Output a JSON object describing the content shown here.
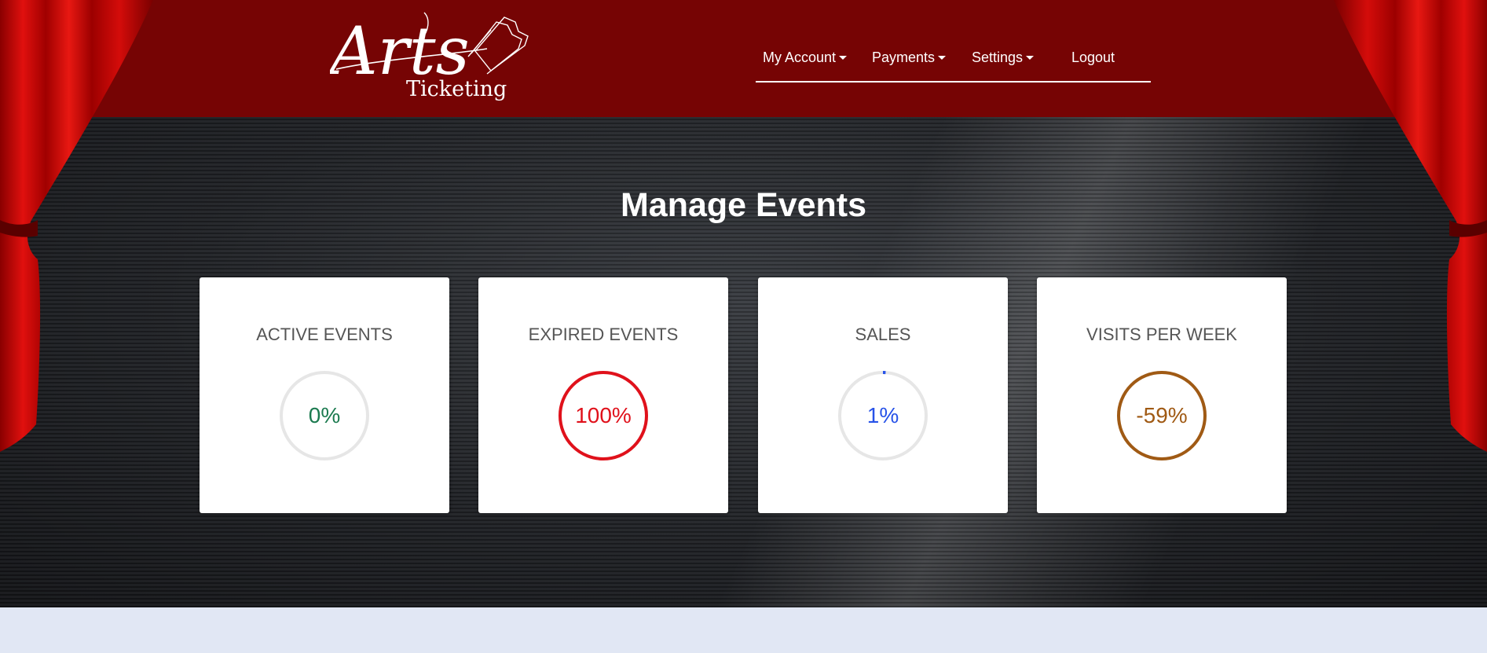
{
  "app": {
    "logo_text": "Arts",
    "logo_subtext": "Ticketing"
  },
  "nav": {
    "items": [
      {
        "label": "My Account",
        "has_dropdown": true
      },
      {
        "label": "Payments",
        "has_dropdown": true
      },
      {
        "label": "Settings",
        "has_dropdown": true
      },
      {
        "label": "Logout",
        "has_dropdown": false
      }
    ]
  },
  "main": {
    "title": "Manage Events",
    "cards": [
      {
        "title": "ACTIVE EVENTS",
        "value": "0%",
        "percent": 0,
        "color": "#1b7a4f"
      },
      {
        "title": "EXPIRED EVENTS",
        "value": "100%",
        "percent": 100,
        "color": "#e0111b"
      },
      {
        "title": "SALES",
        "value": "1%",
        "percent": 1,
        "color": "#2752e8"
      },
      {
        "title": "VISITS PER WEEK",
        "value": "-59%",
        "percent": 100,
        "color": "#a05a14"
      }
    ]
  },
  "colors": {
    "header_bg": "#760404",
    "ring_track": "#e6e6e6",
    "footer_bg": "#e1e7f4"
  }
}
